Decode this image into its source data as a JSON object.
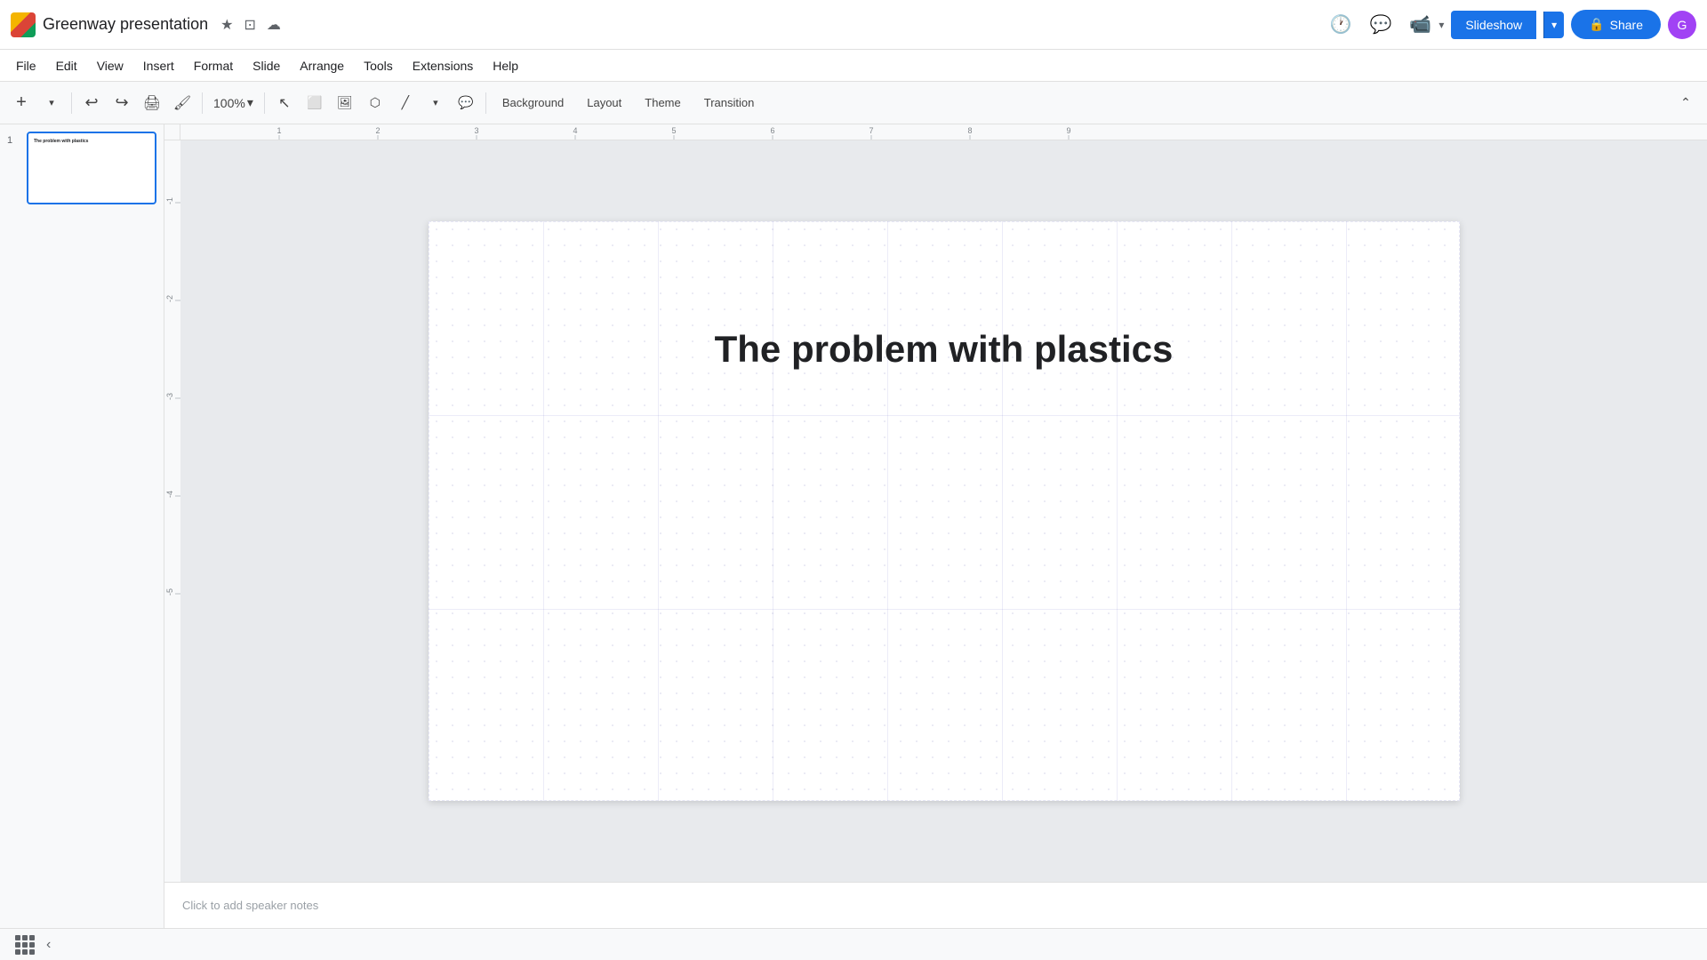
{
  "app": {
    "logo_alt": "Google Slides logo"
  },
  "title_bar": {
    "doc_title": "Greenway presentation",
    "star_icon": "★",
    "folder_icon": "⊡",
    "cloud_icon": "☁",
    "history_icon": "🕐",
    "comment_icon": "💬",
    "video_icon": "📹",
    "slideshow_label": "Slideshow",
    "slideshow_dropdown_icon": "▾",
    "share_icon": "🔒",
    "share_label": "Share",
    "avatar_initials": "G"
  },
  "menu": {
    "items": [
      "File",
      "Edit",
      "View",
      "Insert",
      "Format",
      "Slide",
      "Arrange",
      "Tools",
      "Extensions",
      "Help"
    ]
  },
  "toolbar": {
    "zoom_level": "100%",
    "format_buttons": [
      "Background",
      "Layout",
      "Theme",
      "Transition"
    ],
    "collapse_icon": "⌃"
  },
  "slides_panel": {
    "slides": [
      {
        "num": "1",
        "thumb_title": "The problem with plastics"
      }
    ]
  },
  "slide": {
    "title": "The problem with plastics"
  },
  "ruler": {
    "h_ticks": [
      "1",
      "2",
      "3",
      "4",
      "5",
      "6",
      "7",
      "8",
      "9"
    ],
    "v_ticks": [
      "-1",
      "-2",
      "-3",
      "-4",
      "-5"
    ]
  },
  "notes": {
    "placeholder": "Click to add speaker notes"
  },
  "status_bar": {
    "grid_icon": "grid",
    "chevron_icon": "‹"
  }
}
